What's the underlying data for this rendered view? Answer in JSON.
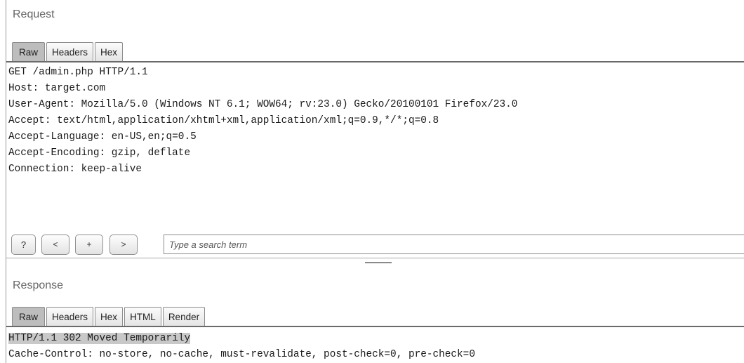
{
  "request": {
    "title": "Request",
    "tabs": [
      "Raw",
      "Headers",
      "Hex"
    ],
    "lines": [
      "GET /admin.php HTTP/1.1",
      "Host: target.com",
      "User-Agent: Mozilla/5.0 (Windows NT 6.1; WOW64; rv:23.0) Gecko/20100101 Firefox/23.0",
      "Accept: text/html,application/xhtml+xml,application/xml;q=0.9,*/*;q=0.8",
      "Accept-Language: en-US,en;q=0.5",
      "Accept-Encoding: gzip, deflate",
      "Connection: keep-alive"
    ]
  },
  "search": {
    "help_label": "?",
    "prev_label": "<",
    "add_label": "+",
    "next_label": ">",
    "placeholder": "Type a search term"
  },
  "response": {
    "title": "Response",
    "tabs": [
      "Raw",
      "Headers",
      "Hex",
      "HTML",
      "Render"
    ],
    "lines": [
      "HTTP/1.1 302 Moved Temporarily",
      "Cache-Control: no-store, no-cache, must-revalidate, post-check=0, pre-check=0"
    ]
  }
}
